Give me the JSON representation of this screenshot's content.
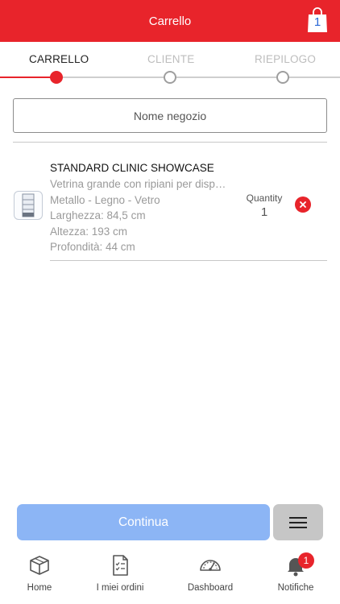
{
  "header": {
    "title": "Carrello",
    "cart_count": "1"
  },
  "stepper": {
    "steps": [
      {
        "label": "CARRELLO",
        "active": true
      },
      {
        "label": "CLIENTE",
        "active": false
      },
      {
        "label": "RIEPILOGO",
        "active": false
      }
    ]
  },
  "store": {
    "placeholder": "Nome negozio",
    "value": ""
  },
  "cart": {
    "items": [
      {
        "name": "STANDARD CLINIC SHOWCASE",
        "description": "Vetrina grande con ripiani per disp…",
        "materials": "Metallo - Legno - Vetro",
        "width": "Larghezza: 84,5 cm",
        "height": "Altezza: 193 cm",
        "depth": "Profondità: 44 cm",
        "quantity_label": "Quantity",
        "quantity": "1",
        "icon": "showcase-thumbnail"
      }
    ]
  },
  "actions": {
    "continue_label": "Continua",
    "menu_icon": "hamburger-icon"
  },
  "tabbar": {
    "tabs": [
      {
        "label": "Home",
        "icon": "package-icon"
      },
      {
        "label": "I miei ordini",
        "icon": "orders-list-icon"
      },
      {
        "label": "Dashboard",
        "icon": "gauge-icon"
      },
      {
        "label": "Notifiche",
        "icon": "bell-icon",
        "badge": "1"
      }
    ]
  },
  "colors": {
    "brand_red": "#e8242b",
    "continue_button": "#8cb5f5",
    "menu_button": "#c6c6c6",
    "cart_count_blue": "#2a68d6"
  }
}
